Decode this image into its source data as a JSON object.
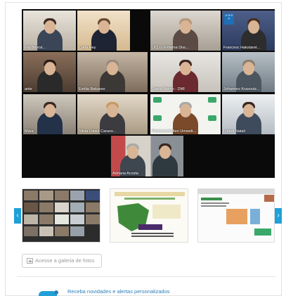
{
  "meeting": {
    "participants": [
      {
        "name": "Pál Beorst..."
      },
      {
        "name": "Carla Hey"
      },
      {
        "name": "UCLG Fritiama Disc..."
      },
      {
        "name": "Francesc Hakstaret..."
      },
      {
        "name": "ante"
      },
      {
        "name": "Emilia Bakasso"
      },
      {
        "name": "Joana Alemo - DMI"
      },
      {
        "name": "Johannes Krasoutz..."
      },
      {
        "name": "Mara"
      },
      {
        "name": "Silvia Lopez Carazo..."
      },
      {
        "name": "Partnerschaften Umwelt..."
      },
      {
        "name": "Luana Natali"
      },
      {
        "name": "Adriana Acosta"
      }
    ],
    "logos": {
      "undp": "U N D P"
    }
  },
  "carousel": {
    "prev_icon": "chevron-left-icon",
    "next_icon": "chevron-right-icon",
    "prev_glyph": "‹",
    "next_glyph": "›"
  },
  "gallery": {
    "button_label": "Acesse a galeria de fotos",
    "icon": "image-icon"
  },
  "newsletter": {
    "text": "Receba novidades e alertas personalizados",
    "icon": "bell-icon"
  },
  "colors": {
    "accent": "#1fa0d8",
    "link": "#2c7fb8"
  }
}
